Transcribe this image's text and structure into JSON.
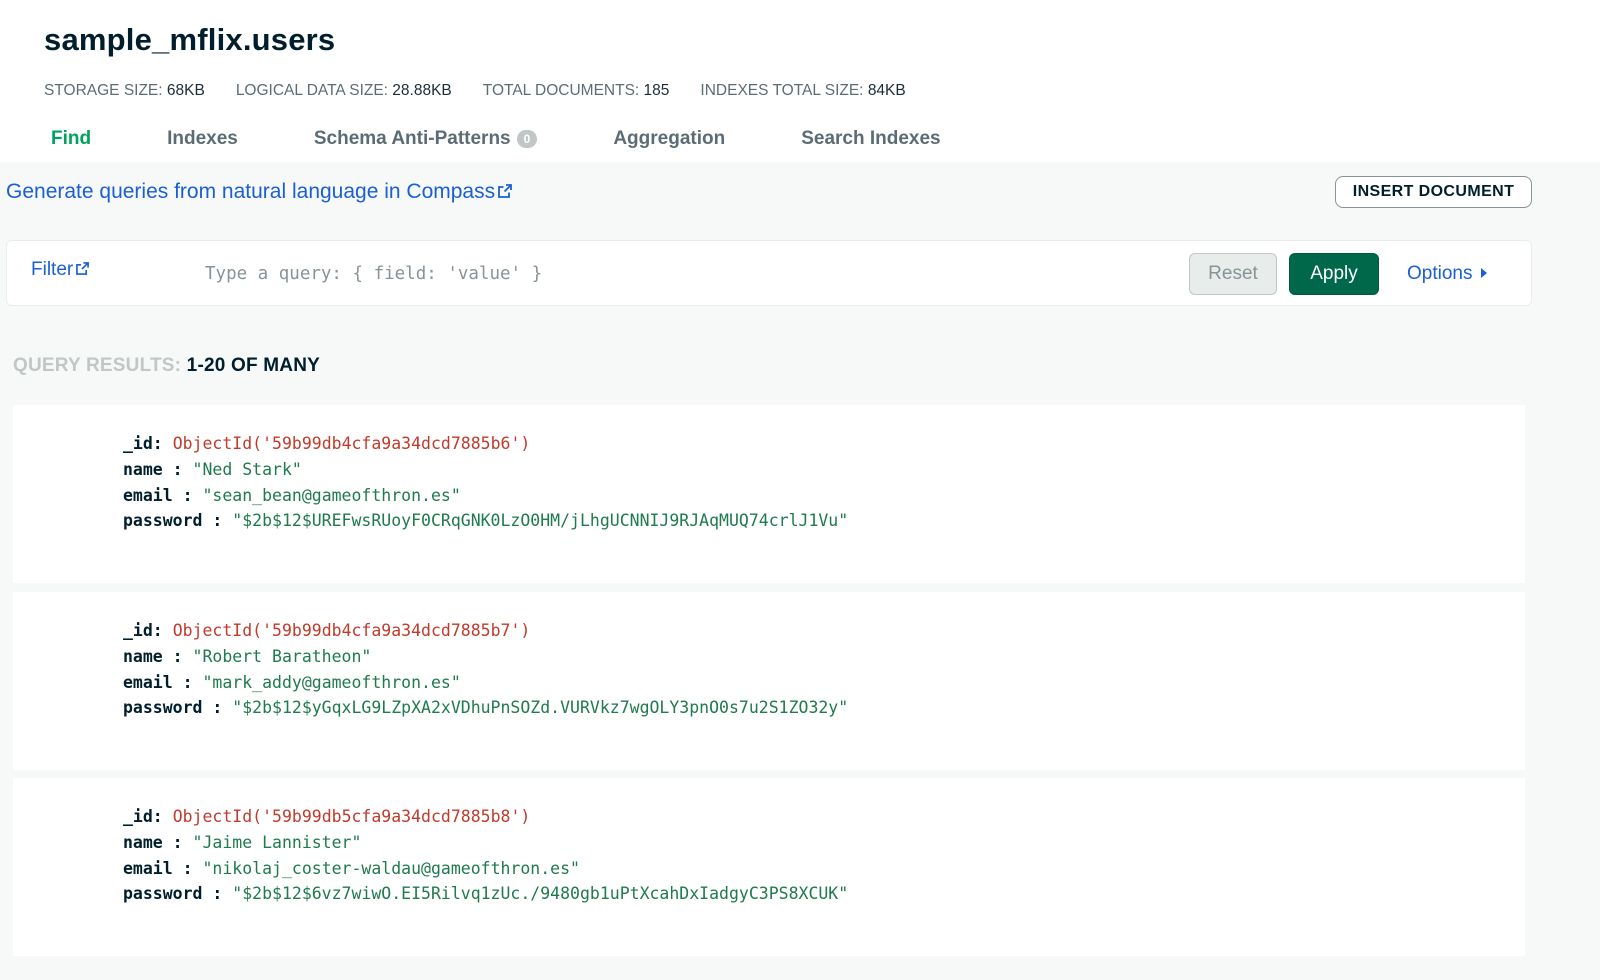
{
  "collection": {
    "title": "sample_mflix.users",
    "stats": [
      {
        "key": "STORAGE SIZE:",
        "value": "68KB"
      },
      {
        "key": "LOGICAL DATA SIZE:",
        "value": "28.88KB"
      },
      {
        "key": "TOTAL DOCUMENTS:",
        "value": "185"
      },
      {
        "key": "INDEXES TOTAL SIZE:",
        "value": "84KB"
      }
    ]
  },
  "tabs": [
    {
      "label": "Find",
      "active": true
    },
    {
      "label": "Indexes"
    },
    {
      "label": "Schema Anti-Patterns",
      "badge": "0"
    },
    {
      "label": "Aggregation"
    },
    {
      "label": "Search Indexes"
    }
  ],
  "toolbar": {
    "nl_link": "Generate queries from natural language in Compass",
    "insert_label": "INSERT DOCUMENT"
  },
  "filter": {
    "label": "Filter",
    "placeholder": "Type a query: { field: 'value' }",
    "value": "",
    "reset_label": "Reset",
    "apply_label": "Apply",
    "options_label": "Options"
  },
  "results": {
    "label": "QUERY RESULTS:",
    "range": "1-20 OF MANY",
    "documents": [
      {
        "id_key": "_id:",
        "id_value": "ObjectId('59b99db4cfa9a34dcd7885b6')",
        "name_key": "name :",
        "name_value": "\"Ned Stark\"",
        "email_key": "email :",
        "email_value": "\"sean_bean@gameofthron.es\"",
        "password_key": "password :",
        "password_value": "\"$2b$12$UREFwsRUoyF0CRqGNK0LzO0HM/jLhgUCNNIJ9RJAqMUQ74crlJ1Vu\""
      },
      {
        "id_key": "_id:",
        "id_value": "ObjectId('59b99db4cfa9a34dcd7885b7')",
        "name_key": "name :",
        "name_value": "\"Robert Baratheon\"",
        "email_key": "email :",
        "email_value": "\"mark_addy@gameofthron.es\"",
        "password_key": "password :",
        "password_value": "\"$2b$12$yGqxLG9LZpXA2xVDhuPnSOZd.VURVkz7wgOLY3pnO0s7u2S1ZO32y\""
      },
      {
        "id_key": "_id:",
        "id_value": "ObjectId('59b99db5cfa9a34dcd7885b8')",
        "name_key": "name :",
        "name_value": "\"Jaime Lannister\"",
        "email_key": "email :",
        "email_value": "\"nikolaj_coster-waldau@gameofthron.es\"",
        "password_key": "password :",
        "password_value": "\"$2b$12$6vz7wiwO.EI5Rilvq1zUc./9480gb1uPtXcahDxIadgyC3PS8XCUK\""
      }
    ]
  },
  "colors": {
    "accent_green": "#00a35c",
    "apply_green": "#00684a",
    "link_blue": "#1a5fd6",
    "objectid_red": "#c23a2b",
    "string_green": "#1f7a4d"
  },
  "icons": {
    "external": "external-link-icon",
    "options": "caret-right-icon"
  }
}
